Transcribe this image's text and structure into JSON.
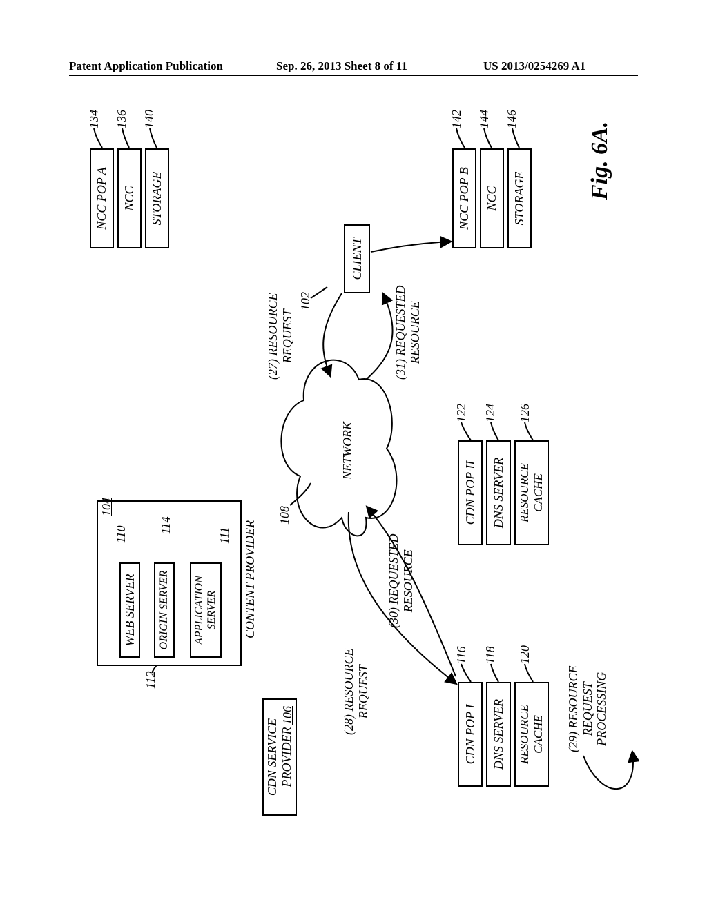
{
  "header": {
    "left": "Patent Application Publication",
    "center": "Sep. 26, 2013  Sheet 8 of 11",
    "right": "US 2013/0254269 A1"
  },
  "figure_label": "Fig. 6A.",
  "content_provider": {
    "ref": "104",
    "label": "CONTENT PROVIDER",
    "web_server": {
      "label": "WEB SERVER",
      "ref": "110"
    },
    "origin_server": {
      "label": "ORIGIN SERVER",
      "ref": "112"
    },
    "db": {
      "ref": "114"
    },
    "app_server": {
      "label": "APPLICATION\nSERVER",
      "ref": "111"
    }
  },
  "cdn_service_provider": {
    "label": "CDN SERVICE\nPROVIDER",
    "ref": "106"
  },
  "ncc_a": {
    "pop": {
      "label": "NCC POP A",
      "ref": "134"
    },
    "ncc": {
      "label": "NCC",
      "ref": "136"
    },
    "storage": {
      "label": "STORAGE",
      "ref": "140"
    }
  },
  "ncc_b": {
    "pop": {
      "label": "NCC POP B",
      "ref": "142"
    },
    "ncc": {
      "label": "NCC",
      "ref": "144"
    },
    "storage": {
      "label": "STORAGE",
      "ref": "146"
    }
  },
  "cdn_pop_1": {
    "pop": {
      "label": "CDN POP I",
      "ref": "116"
    },
    "dns": {
      "label": "DNS SERVER",
      "ref": "118"
    },
    "cache": {
      "label": "RESOURCE\nCACHE",
      "ref": "120"
    }
  },
  "cdn_pop_2": {
    "pop": {
      "label": "CDN POP II",
      "ref": "122"
    },
    "dns": {
      "label": "DNS SERVER",
      "ref": "124"
    },
    "cache": {
      "label": "RESOURCE\nCACHE",
      "ref": "126"
    }
  },
  "client": {
    "label": "CLIENT",
    "ref": "102"
  },
  "network": {
    "label": "NETWORK",
    "ref": "108"
  },
  "flows": {
    "f27": "(27) RESOURCE\nREQUEST",
    "f28": "(28) RESOURCE\nREQUEST",
    "f29": "(29) RESOURCE\nREQUEST\nPROCESSING",
    "f30": "(30) REQUESTED\nRESOURCE",
    "f31": "(31) REQUESTED\nRESOURCE"
  }
}
